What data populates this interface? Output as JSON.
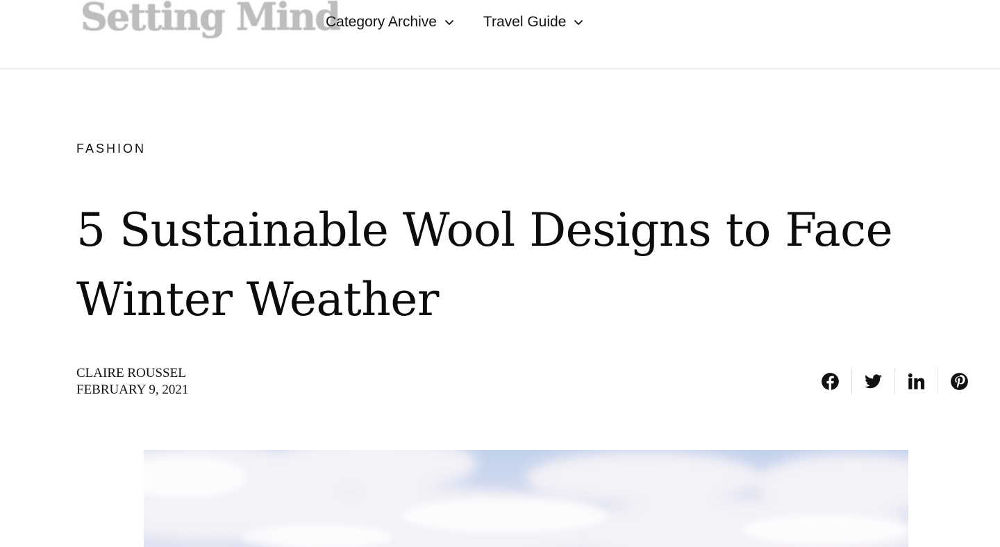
{
  "header": {
    "logo_text": "Setting Mind",
    "nav": [
      {
        "label": "Category Archive",
        "icon": "chevron-down-icon"
      },
      {
        "label": "Travel Guide",
        "icon": "chevron-down-icon"
      }
    ]
  },
  "post": {
    "category": "FASHION",
    "title": "5 Sustainable Wool Designs to Face Winter Weather",
    "author": "CLAIRE ROUSSEL",
    "date": "FEBRUARY 9, 2021"
  },
  "share": [
    {
      "network": "facebook",
      "icon": "facebook-icon"
    },
    {
      "network": "twitter",
      "icon": "twitter-icon"
    },
    {
      "network": "linkedin",
      "icon": "linkedin-icon"
    },
    {
      "network": "pinterest",
      "icon": "pinterest-icon"
    }
  ],
  "hero": {
    "subject": "cloudy sky photo",
    "colors": {
      "sky": "#c9d7ee",
      "cloud": "#f3f1f7",
      "tint": "#e7e3f0"
    }
  },
  "colors": {
    "text": "#111111",
    "logo": "#bdbdbd",
    "divider": "#eeeeee",
    "background": "#ffffff"
  }
}
